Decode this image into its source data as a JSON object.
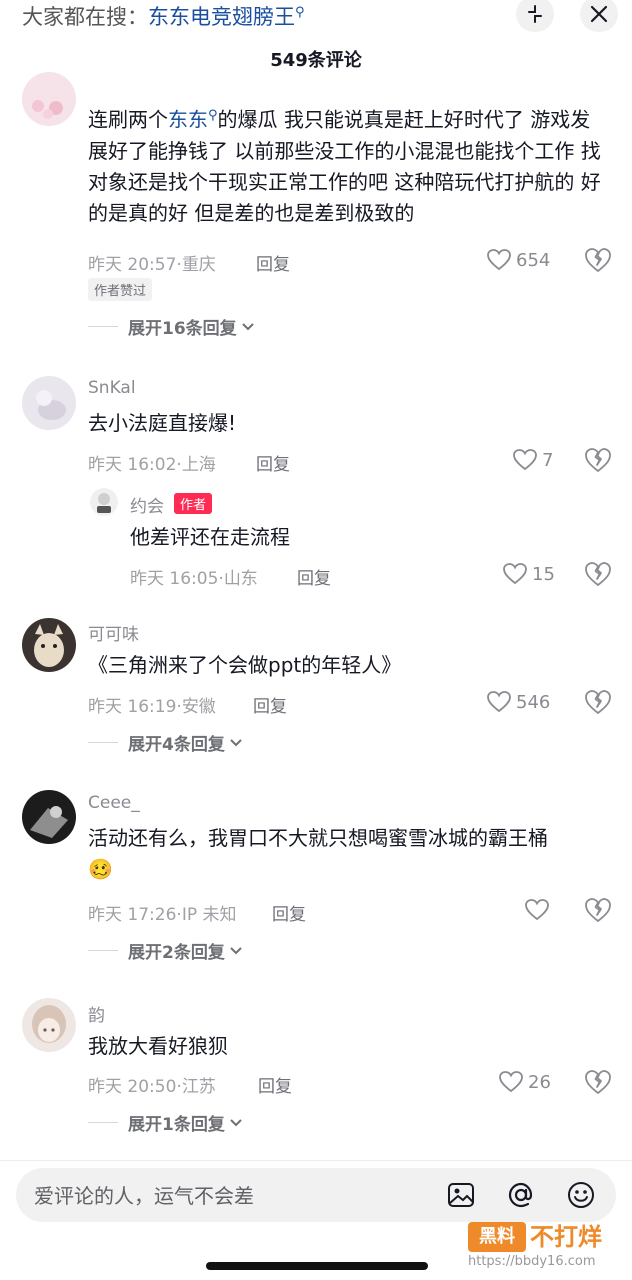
{
  "topbar": {
    "search_prefix": "大家都在搜：",
    "search_keyword": "东东电竞翅膀王",
    "search_glyph": "⚲"
  },
  "header": {
    "comment_count": "549条评论"
  },
  "comments": [
    {
      "text_before": "连刷两个",
      "text_link": "东东",
      "link_glyph": "⚲",
      "text_after": "的爆瓜 我只能说真是赶上好时代了 游戏发展好了能挣钱了 以前那些没工作的小混混也能找个工作 找对象还是找个干现实正常工作的吧 这种陪玩代打护航的 好的是真的好 但是差的也是差到极致的",
      "time": "昨天 20:57",
      "location": "重庆",
      "reply_label": "回复",
      "likes": "654",
      "author_liked": "作者赞过",
      "expand": "展开16条回复"
    },
    {
      "nickname": "SnKal",
      "text": "去小法庭直接爆!",
      "time": "昨天 16:02",
      "location": "上海",
      "reply_label": "回复",
      "likes": "7",
      "reply": {
        "nickname": "约会",
        "badge": "作者",
        "text": "他差评还在走流程",
        "time": "昨天 16:05",
        "location": "山东",
        "reply_label": "回复",
        "likes": "15"
      }
    },
    {
      "nickname": "可可味",
      "text": "《三角洲来了个会做ppt的年轻人》",
      "time": "昨天 16:19",
      "location": "安徽",
      "reply_label": "回复",
      "likes": "546",
      "expand": "展开4条回复"
    },
    {
      "nickname": "Ceee_",
      "text": "活动还有么，我胃口不大就只想喝蜜雪冰城的霸王桶",
      "emoji": "🥴",
      "time": "昨天 17:26",
      "location": "IP 未知",
      "reply_label": "回复",
      "likes": "",
      "expand": "展开2条回复"
    },
    {
      "nickname": "韵",
      "text": "我放大看好狼狈",
      "time": "昨天 20:50",
      "location": "江苏",
      "reply_label": "回复",
      "likes": "26",
      "expand": "展开1条回复"
    }
  ],
  "meta_separator": "·",
  "input": {
    "placeholder": "爱评论的人，运气不会差"
  },
  "watermark": {
    "logo": "黑料",
    "name": "不打烊",
    "url": "https://bbdy16.com"
  },
  "colors": {
    "link": "#1a4fa0",
    "author_badge": "#fe2c55",
    "watermark": "#ee8a2a"
  }
}
